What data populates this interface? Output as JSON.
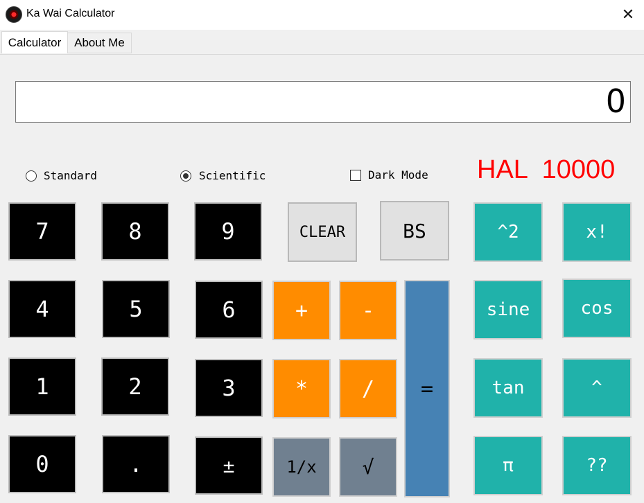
{
  "window": {
    "title": "Ka Wai Calculator",
    "close_label": "✕"
  },
  "tabs": [
    {
      "label": "Calculator",
      "selected": true
    },
    {
      "label": "About Me",
      "selected": false
    }
  ],
  "display": {
    "value": "0"
  },
  "mode": {
    "standard_label": "Standard",
    "scientific_label": "Scientific",
    "selected": "Scientific",
    "dark_mode_label": "Dark Mode",
    "dark_mode_checked": false
  },
  "branding": {
    "text": "HAL  10000",
    "color": "#ff0000"
  },
  "buttons": {
    "seven": "7",
    "eight": "8",
    "nine": "9",
    "four": "4",
    "five": "5",
    "six": "6",
    "one": "1",
    "two": "2",
    "three": "3",
    "zero": "0",
    "dot": ".",
    "plusminus": "±",
    "clear": "CLEAR",
    "backspace": "BS",
    "plus": "+",
    "minus": "-",
    "multiply": "*",
    "divide": "/",
    "reciprocal": "1/x",
    "sqrt": "√",
    "equals": "=",
    "square": "^2",
    "factorial": "x!",
    "sine": "sine",
    "cos": "cos",
    "tan": "tan",
    "power": "^",
    "pi": "π",
    "mystery": "??"
  },
  "colors": {
    "number_bg": "#000000",
    "operator_bg": "#ff8c00",
    "scientific_bg": "#20b2aa",
    "equals_bg": "#4682b4",
    "special_bg": "#708090",
    "control_bg": "#e1e1e1"
  }
}
